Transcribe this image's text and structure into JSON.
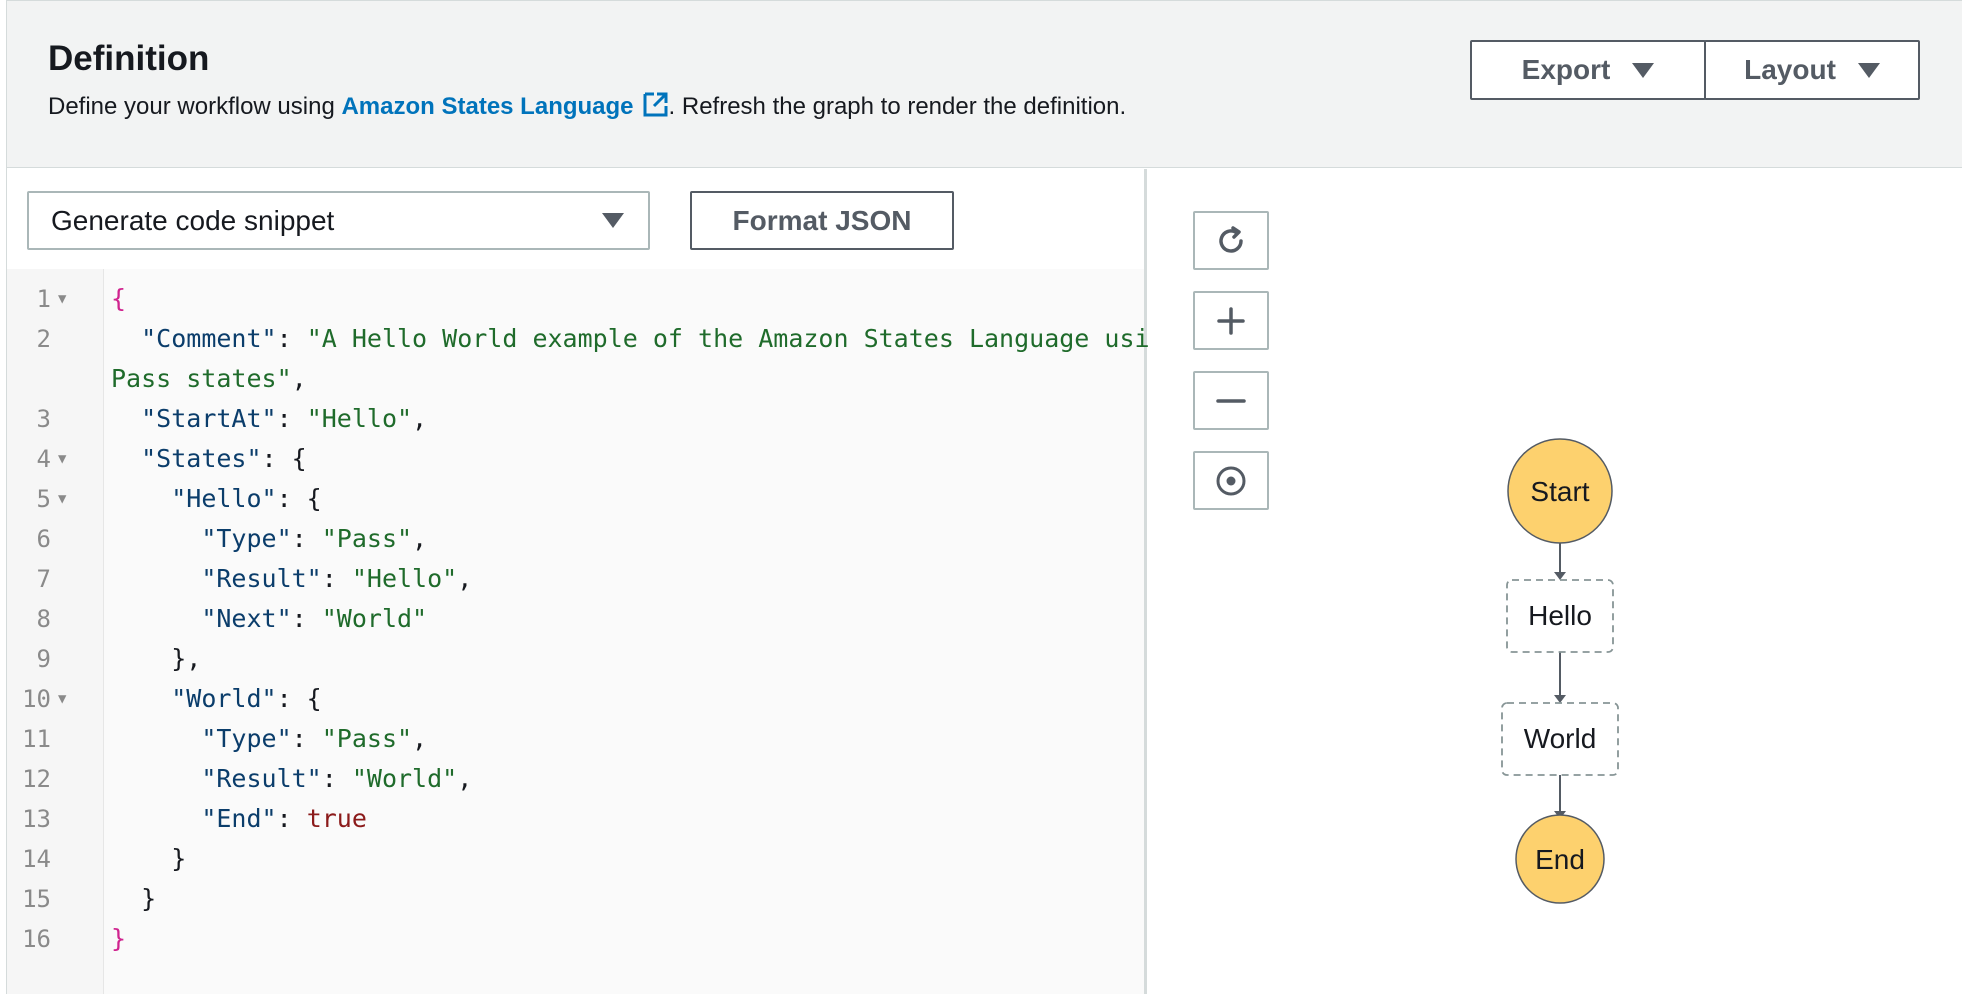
{
  "header": {
    "title": "Definition",
    "subtitle_prefix": "Define your workflow using ",
    "subtitle_link": "Amazon States Language",
    "subtitle_suffix": ". Refresh the graph to render the definition.",
    "export_label": "Export",
    "layout_label": "Layout"
  },
  "toolbar": {
    "snippet_select_value": "Generate code snippet",
    "format_json_label": "Format JSON"
  },
  "code": {
    "line_numbers": [
      "1",
      "2",
      "",
      "3",
      "4",
      "5",
      "6",
      "7",
      "8",
      "9",
      "10",
      "11",
      "12",
      "13",
      "14",
      "15",
      "16"
    ],
    "foldable_lines": [
      "1",
      "4",
      "5",
      "10"
    ]
  },
  "graph": {
    "controls": [
      "refresh-icon",
      "zoom-in-icon",
      "zoom-out-icon",
      "center-icon"
    ],
    "nodes": {
      "start": "Start",
      "hello": "Hello",
      "world": "World",
      "end": "End"
    },
    "colors": {
      "terminal_fill": "#fdd16e",
      "state_border": "#879596",
      "link": "#0073bb"
    }
  }
}
